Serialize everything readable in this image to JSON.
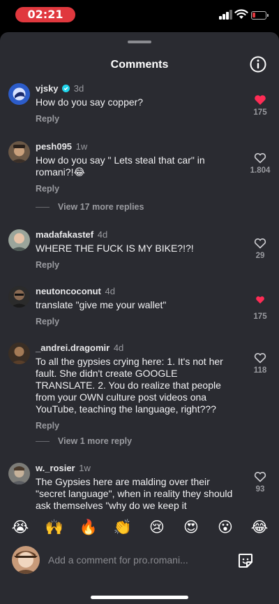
{
  "status_bar": {
    "time": "02:21"
  },
  "header": {
    "title": "Comments"
  },
  "comments": [
    {
      "username": "vjsky",
      "verified": true,
      "age": "3d",
      "text": "How do you say copper?",
      "reply_label": "Reply",
      "likes": "175",
      "liked": true
    },
    {
      "username": "pesh095",
      "verified": false,
      "age": "1w",
      "text": "How do you say \" Lets steal that car\" in romani?!😂",
      "reply_label": "Reply",
      "likes": "1.804",
      "liked": false
    },
    {
      "username": "madafakastef",
      "verified": false,
      "age": "4d",
      "text": "WHERE THE FUCK IS MY BIKE?!?!",
      "reply_label": "Reply",
      "likes": "29",
      "liked": false
    },
    {
      "username": "neutoncoconut",
      "verified": false,
      "age": "4d",
      "text": "translate \"give me your wallet\"",
      "reply_label": "Reply",
      "likes": "175",
      "liked": true
    },
    {
      "username": "_andrei.dragomir",
      "verified": false,
      "age": "4d",
      "text": "To all the gypsies crying here: 1. It's not her fault. She didn't create GOOGLE TRANSLATE.  2. You do realize that people from your OWN culture post videos ona YouTube, teaching the language, right???",
      "reply_label": "Reply",
      "likes": "118",
      "liked": false
    },
    {
      "username": "w._rosier",
      "verified": false,
      "age": "1w",
      "text": "The Gypsies here are malding over their \"secret language\", when in reality they should ask themselves \"why do we keep it",
      "reply_label": "",
      "likes": "93",
      "liked": false
    }
  ],
  "more_replies": [
    {
      "label": "View 17 more replies"
    },
    {
      "label": "View 1 more reply"
    }
  ],
  "emoji_bar": [
    "😭",
    "🙌",
    "🔥",
    "👏",
    "😢",
    "😍",
    "😮",
    "😂"
  ],
  "composer": {
    "placeholder": "Add a comment for pro.romani..."
  },
  "colors": {
    "background": "#2a2b31",
    "like_red": "#fe2c55",
    "muted_text": "#9a9ba0",
    "status_red": "#e0383e",
    "verified_blue": "#20d5ec"
  },
  "icons": [
    "info-icon",
    "verified-icon",
    "heart-icon",
    "sticker-icon"
  ]
}
